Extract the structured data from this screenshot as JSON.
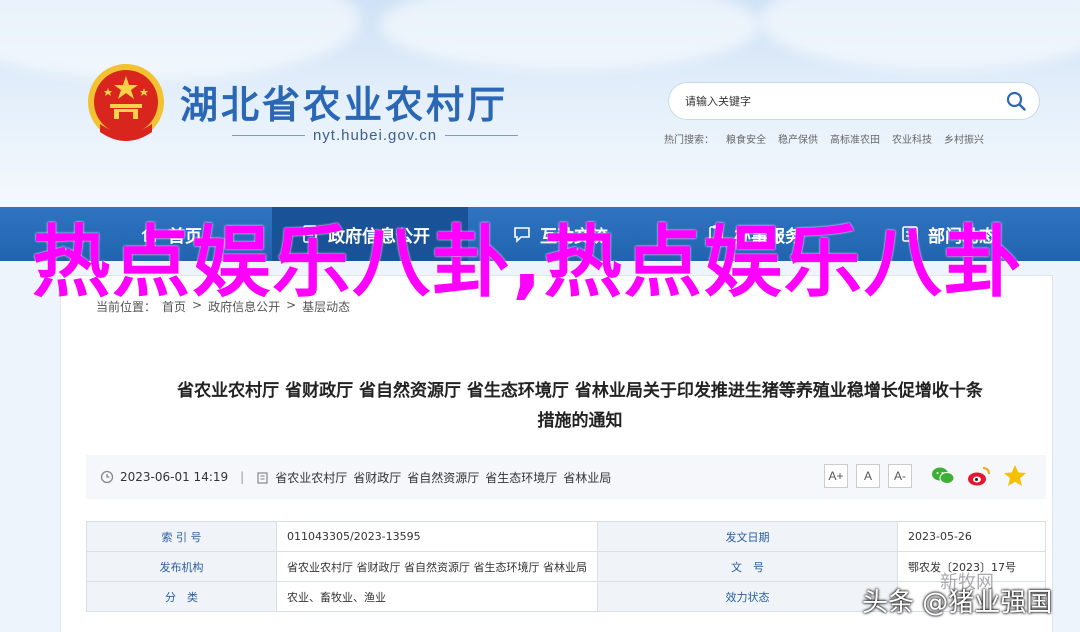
{
  "header": {
    "site_title": "湖北省农业农村厅",
    "domain": "nyt.hubei.gov.cn",
    "search_placeholder": "请输入关键字",
    "hot_label": "热门搜索：",
    "hot_links": [
      "粮食安全",
      "稳产保供",
      "高标准农田",
      "农业科技",
      "乡村振兴"
    ]
  },
  "nav": {
    "items": [
      "首页",
      "政府信息公开",
      "互动交流",
      "办事服务",
      "部门动态"
    ],
    "active_index": 1
  },
  "breadcrumb": [
    "当前位置：",
    "首页",
    ">",
    "政府信息公开",
    ">",
    "基层动态"
  ],
  "article": {
    "title_line1": "省农业农村厅 省财政厅 省自然资源厅 省生态环境厅 省林业局关于印发推进生猪等养殖业稳增长促增收十条",
    "title_line2": "措施的通知",
    "date": "2023-06-01 14:19",
    "divider": "|",
    "sources": [
      "省农业农村厅",
      "省财政厅",
      "省自然资源厅",
      "省生态环境厅",
      "省林业局"
    ],
    "font_sizes": [
      "A+",
      "A",
      "A-"
    ]
  },
  "info_table": {
    "rows": [
      {
        "label1": "索 引 号",
        "value1": "011043305/2023-13595",
        "label2": "发文日期",
        "value2": "2023-05-26"
      },
      {
        "label1": "发布机构",
        "value1": "省农业农村厅 省财政厅 省自然资源厅 省生态环境厅 省林业局",
        "label2": "文　号",
        "value2": "鄂农发〔2023〕17号"
      },
      {
        "label1": "分　类",
        "value1": "农业、畜牧业、渔业",
        "label2": "效力状态",
        "value2": ""
      }
    ]
  },
  "overlay": {
    "text": "热点娱乐八卦,热点娱乐八卦"
  },
  "watermark": {
    "logo_text": "新牧网",
    "text": "头条 @猪业强国"
  },
  "colors": {
    "brand_blue": "#2a67b4",
    "nav_blue": "#2163ae",
    "overlay_magenta": "#ff00ff"
  }
}
